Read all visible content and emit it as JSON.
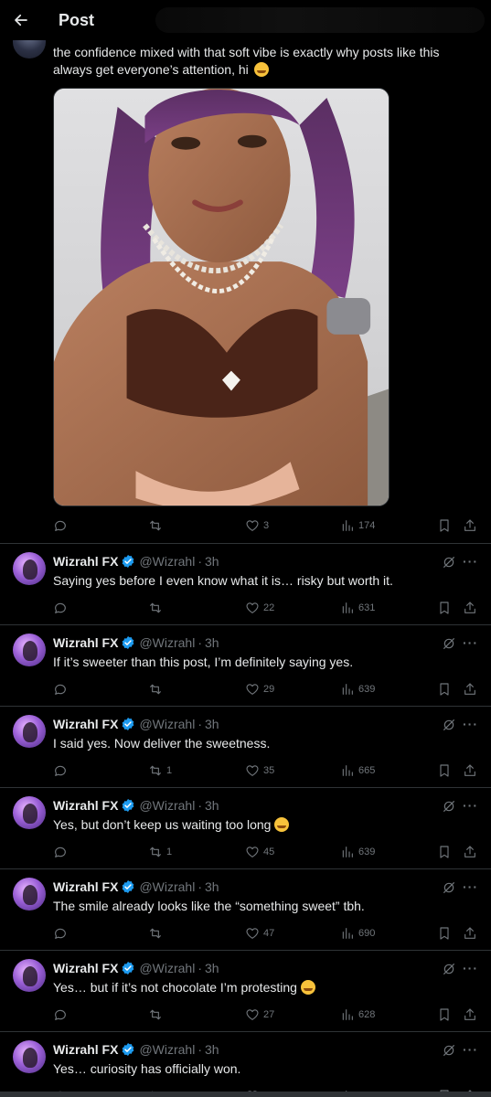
{
  "header": {
    "title": "Post",
    "back_icon": "arrow-left-icon"
  },
  "main_post": {
    "text": "the confidence mixed with that soft vibe is exactly why posts like this always get everyone’s attention, hi",
    "emoji": "grinning-sweat-emoji",
    "image_alt": "photo of woman with purple hair in brown bikini and pearl necklaces",
    "actions": {
      "replies": "",
      "retweets": "",
      "likes": "3",
      "views": "174"
    }
  },
  "replies": [
    {
      "name": "Wizrahl FX",
      "handle": "@Wizrahl",
      "dot": "·",
      "time": "3h",
      "text": "Saying yes before I even know what it is… risky but worth it.",
      "emoji": "",
      "retweets": "",
      "likes": "22",
      "views": "631"
    },
    {
      "name": "Wizrahl FX",
      "handle": "@Wizrahl",
      "dot": "·",
      "time": "3h",
      "text": "If it’s sweeter than this post, I’m definitely saying yes.",
      "emoji": "",
      "retweets": "",
      "likes": "29",
      "views": "639"
    },
    {
      "name": "Wizrahl FX",
      "handle": "@Wizrahl",
      "dot": "·",
      "time": "3h",
      "text": "I said yes. Now deliver the sweetness.",
      "emoji": "",
      "retweets": "1",
      "likes": "35",
      "views": "665"
    },
    {
      "name": "Wizrahl FX",
      "handle": "@Wizrahl",
      "dot": "·",
      "time": "3h",
      "text": "Yes, but don’t keep us waiting too long",
      "emoji": "relieved-face-emoji",
      "retweets": "1",
      "likes": "45",
      "views": "639"
    },
    {
      "name": "Wizrahl FX",
      "handle": "@Wizrahl",
      "dot": "·",
      "time": "3h",
      "text": "The smile already looks like the “something sweet” tbh.",
      "emoji": "",
      "retweets": "",
      "likes": "47",
      "views": "690"
    },
    {
      "name": "Wizrahl FX",
      "handle": "@Wizrahl",
      "dot": "·",
      "time": "3h",
      "text": "Yes… but if it’s not chocolate I’m protesting",
      "emoji": "tears-of-joy-emoji",
      "retweets": "",
      "likes": "27",
      "views": "628"
    },
    {
      "name": "Wizrahl FX",
      "handle": "@Wizrahl",
      "dot": "·",
      "time": "3h",
      "text": "Yes… curiosity has officially won.",
      "emoji": "",
      "retweets": "",
      "likes": "",
      "views": ""
    }
  ],
  "colors": {
    "background": "#000000",
    "text": "#e7e9ea",
    "muted": "#71767b",
    "divider": "#2f3336",
    "verified": "#1d9bf0"
  }
}
